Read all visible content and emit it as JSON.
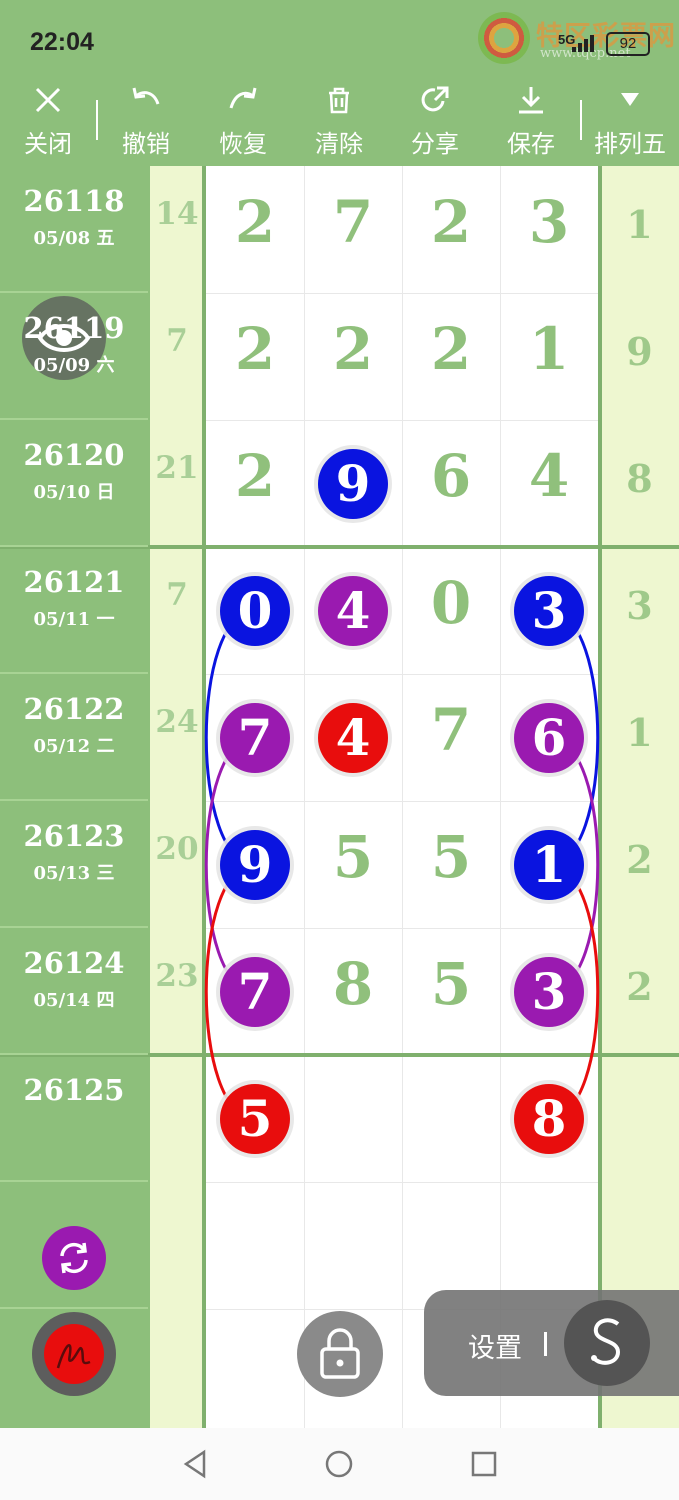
{
  "status": {
    "time": "22:04",
    "network": "5G",
    "battery": "92"
  },
  "watermark": {
    "brand": "特区彩票网",
    "url": "www.tqcp.net"
  },
  "toolbar": {
    "close": "关闭",
    "undo": "撤销",
    "redo": "恢复",
    "clear": "清除",
    "share": "分享",
    "save": "保存",
    "lottery": "排列五"
  },
  "rows": [
    {
      "issue": "26118",
      "date": "05/08 五",
      "sum": "14",
      "digits": [
        "2",
        "7",
        "2",
        "3"
      ],
      "extra": "1"
    },
    {
      "issue": "26119",
      "date": "05/09 六",
      "sum": "7",
      "digits": [
        "2",
        "2",
        "2",
        "1"
      ],
      "extra": "9"
    },
    {
      "issue": "26120",
      "date": "05/10 日",
      "sum": "21",
      "digits": [
        "2",
        "9",
        "6",
        "4"
      ],
      "extra": "8"
    },
    {
      "issue": "26121",
      "date": "05/11 一",
      "sum": "7",
      "digits": [
        "0",
        "4",
        "0",
        "3"
      ],
      "extra": "3"
    },
    {
      "issue": "26122",
      "date": "05/12 二",
      "sum": "24",
      "digits": [
        "7",
        "4",
        "7",
        "6"
      ],
      "extra": "1"
    },
    {
      "issue": "26123",
      "date": "05/13 三",
      "sum": "20",
      "digits": [
        "9",
        "5",
        "5",
        "1"
      ],
      "extra": "2"
    },
    {
      "issue": "26124",
      "date": "05/14 四",
      "sum": "23",
      "digits": [
        "7",
        "8",
        "5",
        "3"
      ],
      "extra": "2"
    },
    {
      "issue": "26125",
      "date": "",
      "sum": "",
      "digits": [
        "5",
        "",
        "",
        "8"
      ],
      "extra": ""
    }
  ],
  "colors": {
    "blue": "#0a14e0",
    "purple": "#9a1ab0",
    "red": "#e80d0d",
    "green_bg": "#8dbf7b",
    "light_col": "#eef7d0",
    "plain_digit": "#90c07c"
  },
  "settings_label": "设置"
}
